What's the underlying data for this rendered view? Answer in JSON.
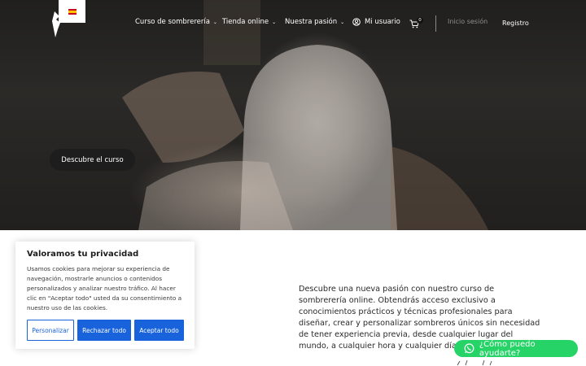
{
  "header": {
    "language_flag": "es",
    "nav": [
      {
        "label": "Curso de sombrerería",
        "has_dropdown": true
      },
      {
        "label": "Tienda online",
        "has_dropdown": true
      },
      {
        "label": "Nuestra pasión",
        "has_dropdown": true
      }
    ],
    "user_label": "Mi usuario",
    "cart_count": "0",
    "login_label": "Inicio sesión",
    "register_label": "Registro"
  },
  "hero": {
    "cta_label": "Descubre el curso"
  },
  "main": {
    "paragraph": "Descubre una nueva pasión con nuestro curso de sombrerería online.  Obtendrás acceso exclusivo a conocimientos prácticos y técnicas profesionales para diseñar, crear y personalizar sombreros únicos sin necesidad de tener experiencia previa, desde cualquier lugar del mundo, a cualquier hora y cualquier día del año."
  },
  "cookie_banner": {
    "title": "Valoramos tu privacidad",
    "text": "Usamos cookies para mejorar su experiencia de navegación, mostrarle anuncios o contenidos personalizados y analizar nuestro tráfico. Al hacer clic en \"Aceptar todo\" usted da su consentimiento a nuestro uso de las cookies.",
    "customize_label": "Personalizar",
    "reject_label": "Rechazar todo",
    "accept_label": "Aceptar todo"
  },
  "whatsapp": {
    "label": "¿Cómo puedo ayudarte?"
  },
  "colors": {
    "primary_blue": "#1863dc",
    "whatsapp_green": "#25d366",
    "hero_button": "#1d1d1d"
  }
}
